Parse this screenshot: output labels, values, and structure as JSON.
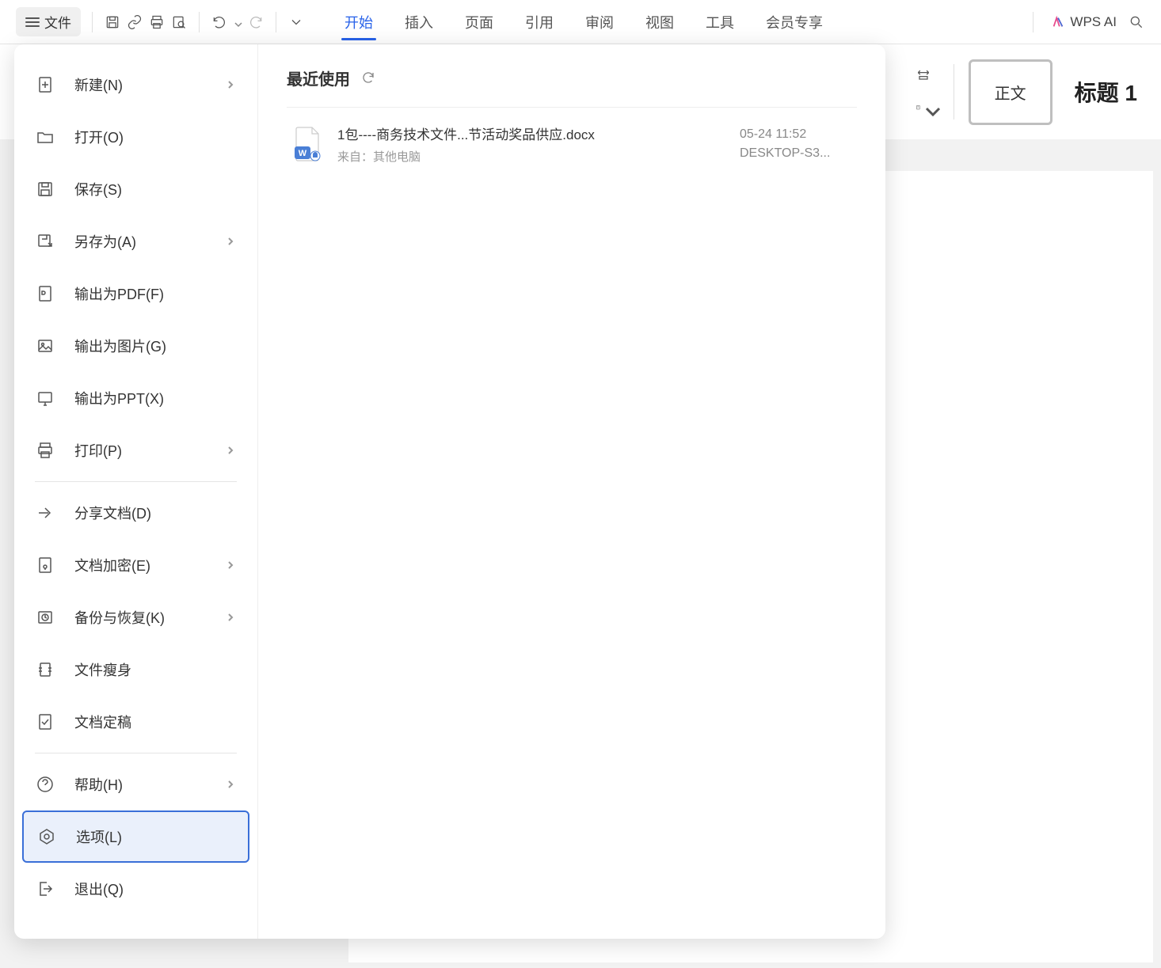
{
  "toolbar": {
    "file_label": "文件",
    "wps_ai_label": "WPS AI"
  },
  "ribbon": {
    "tabs": [
      "开始",
      "插入",
      "页面",
      "引用",
      "审阅",
      "视图",
      "工具",
      "会员专享"
    ],
    "active_index": 0
  },
  "styles": {
    "normal": "正文",
    "heading1": "标题  1"
  },
  "file_menu": {
    "items": [
      {
        "label": "新建(N)",
        "has_sub": true
      },
      {
        "label": "打开(O)",
        "has_sub": false
      },
      {
        "label": "保存(S)",
        "has_sub": false
      },
      {
        "label": "另存为(A)",
        "has_sub": true
      },
      {
        "label": "输出为PDF(F)",
        "has_sub": false
      },
      {
        "label": "输出为图片(G)",
        "has_sub": false
      },
      {
        "label": "输出为PPT(X)",
        "has_sub": false
      },
      {
        "label": "打印(P)",
        "has_sub": true
      },
      {
        "label": "分享文档(D)",
        "has_sub": false
      },
      {
        "label": "文档加密(E)",
        "has_sub": true
      },
      {
        "label": "备份与恢复(K)",
        "has_sub": true
      },
      {
        "label": "文件瘦身",
        "has_sub": false
      },
      {
        "label": "文档定稿",
        "has_sub": false
      },
      {
        "label": "帮助(H)",
        "has_sub": true
      },
      {
        "label": "选项(L)",
        "has_sub": false
      },
      {
        "label": "退出(Q)",
        "has_sub": false
      }
    ],
    "selected_index": 14,
    "dividers_after": [
      7,
      12
    ]
  },
  "recent": {
    "title": "最近使用",
    "items": [
      {
        "filename": "1包----商务技术文件...节活动奖品供应.docx",
        "source": "来自：其他电脑",
        "time": "05-24 11:52",
        "device": "DESKTOP-S3..."
      }
    ]
  }
}
